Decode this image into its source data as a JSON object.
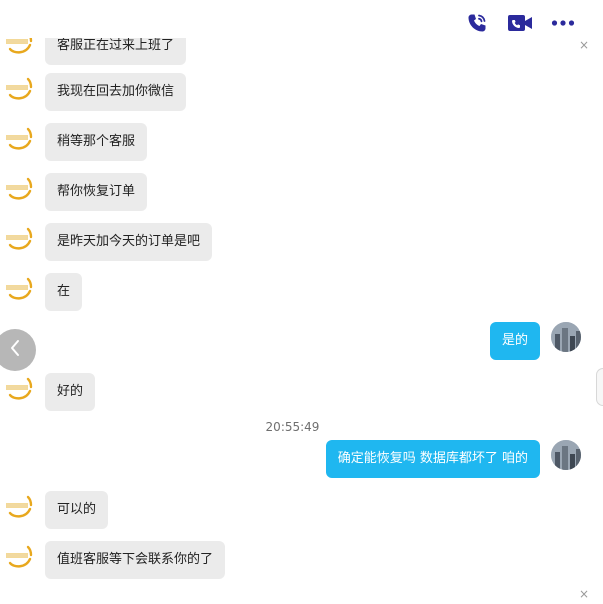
{
  "topbar": {
    "icons": [
      "phone-call-icon",
      "video-call-icon",
      "more-options-icon"
    ]
  },
  "colors": {
    "accent": "#2b2a9c",
    "bubble_out": "#1fb7f0",
    "bubble_in": "#ebebeb"
  },
  "messages": [
    {
      "side": "left",
      "text": "客服正在过来上班了"
    },
    {
      "side": "left",
      "text": "我现在回去加你微信"
    },
    {
      "side": "left",
      "text": "稍等那个客服"
    },
    {
      "side": "left",
      "text": "帮你恢复订单"
    },
    {
      "side": "left",
      "text": "是昨天加今天的订单是吧"
    },
    {
      "side": "left",
      "text": "在"
    },
    {
      "side": "right",
      "text": "是的"
    },
    {
      "side": "left",
      "text": "好的"
    },
    {
      "side": "right",
      "text": "确定能恢复吗 数据库都坏了 咱的"
    },
    {
      "side": "left",
      "text": "可以的"
    },
    {
      "side": "left",
      "text": "值班客服等下会联系你的了"
    }
  ],
  "timestamp": "20:55:49",
  "close_glyph": "×",
  "back_icon": "chevron-left-icon"
}
